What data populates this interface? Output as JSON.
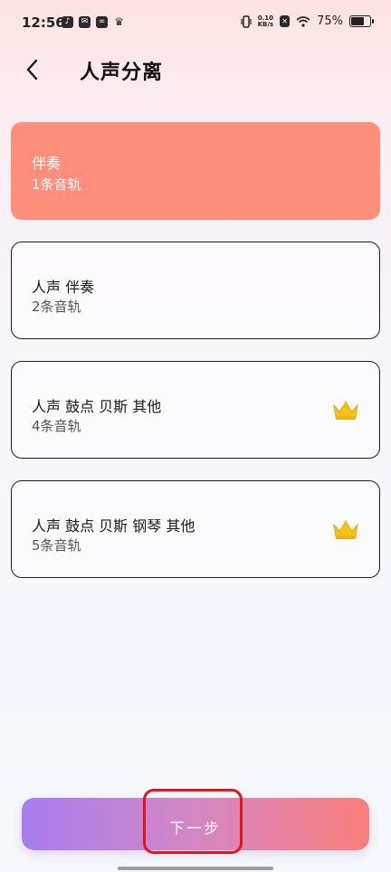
{
  "status_bar": {
    "time": "12:56",
    "net_speed_value": "0.10",
    "net_speed_unit": "KB/s",
    "battery": "75%",
    "battery_level": 0.75
  },
  "header": {
    "title": "人声分离"
  },
  "options": [
    {
      "name": "伴奏",
      "tracks": "1条音轨",
      "selected": true,
      "premium": false
    },
    {
      "name": "人声 伴奏",
      "tracks": "2条音轨",
      "selected": false,
      "premium": false
    },
    {
      "name": "人声 鼓点 贝斯 其他",
      "tracks": "4条音轨",
      "selected": false,
      "premium": true
    },
    {
      "name": "人声 鼓点 贝斯 钢琴 其他",
      "tracks": "5条音轨",
      "selected": false,
      "premium": true
    }
  ],
  "footer": {
    "next_label": "下一步"
  },
  "colors": {
    "selected_card": "#ff8f7c",
    "button_gradient_start": "#a77ef0",
    "button_gradient_end": "#fb7e7c",
    "crown": "#f5c21b",
    "highlight": "#e0161a"
  }
}
